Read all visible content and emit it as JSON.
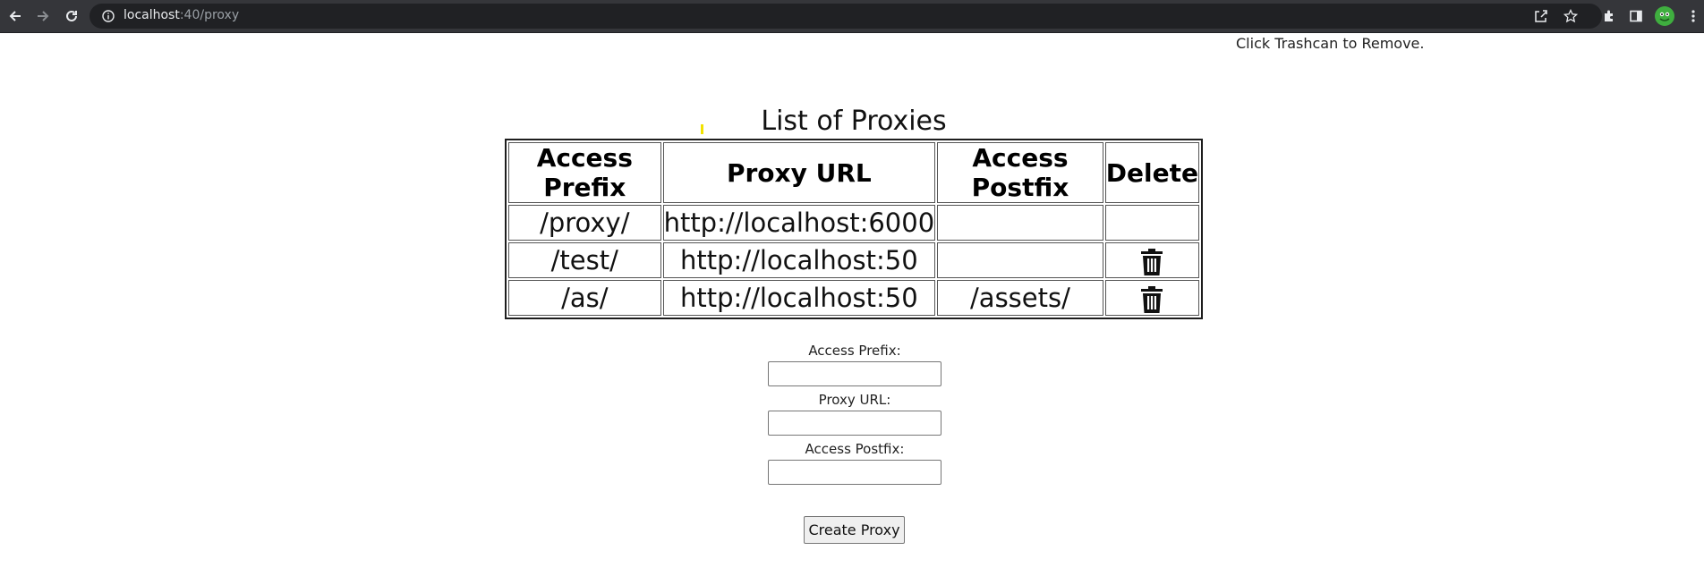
{
  "browser": {
    "url_host": "localhost",
    "url_path": ":40/proxy"
  },
  "page": {
    "hint": "Click Trashcan to Remove.",
    "table_caption": "List of Proxies"
  },
  "table": {
    "headers": [
      "Access Prefix",
      "Proxy URL",
      "Access Postfix",
      "Delete"
    ],
    "rows": [
      {
        "prefix": "/proxy/",
        "url": "http://localhost:6000",
        "postfix": "",
        "deletable": false
      },
      {
        "prefix": "/test/",
        "url": "http://localhost:50",
        "postfix": "",
        "deletable": true
      },
      {
        "prefix": "/as/",
        "url": "http://localhost:50",
        "postfix": "/assets/",
        "deletable": true
      }
    ]
  },
  "form": {
    "prefix_label": "Access Prefix:",
    "url_label": "Proxy URL:",
    "postfix_label": "Access Postfix:",
    "prefix_value": "",
    "url_value": "",
    "postfix_value": "",
    "submit_label": "Create Proxy"
  },
  "icons": {
    "back": "back-arrow-icon",
    "forward": "forward-arrow-icon",
    "reload": "reload-icon",
    "info": "info-icon",
    "share": "share-icon",
    "bookmark": "star-icon",
    "extensions": "puzzle-icon",
    "sidepanel": "side-panel-icon",
    "profile": "avatar",
    "menu": "kebab-menu-icon",
    "delete": "trash-icon"
  },
  "colors": {
    "chrome_bg": "#35363a",
    "omnibox_bg": "#202124",
    "cursor_mark": "#f2e200"
  }
}
